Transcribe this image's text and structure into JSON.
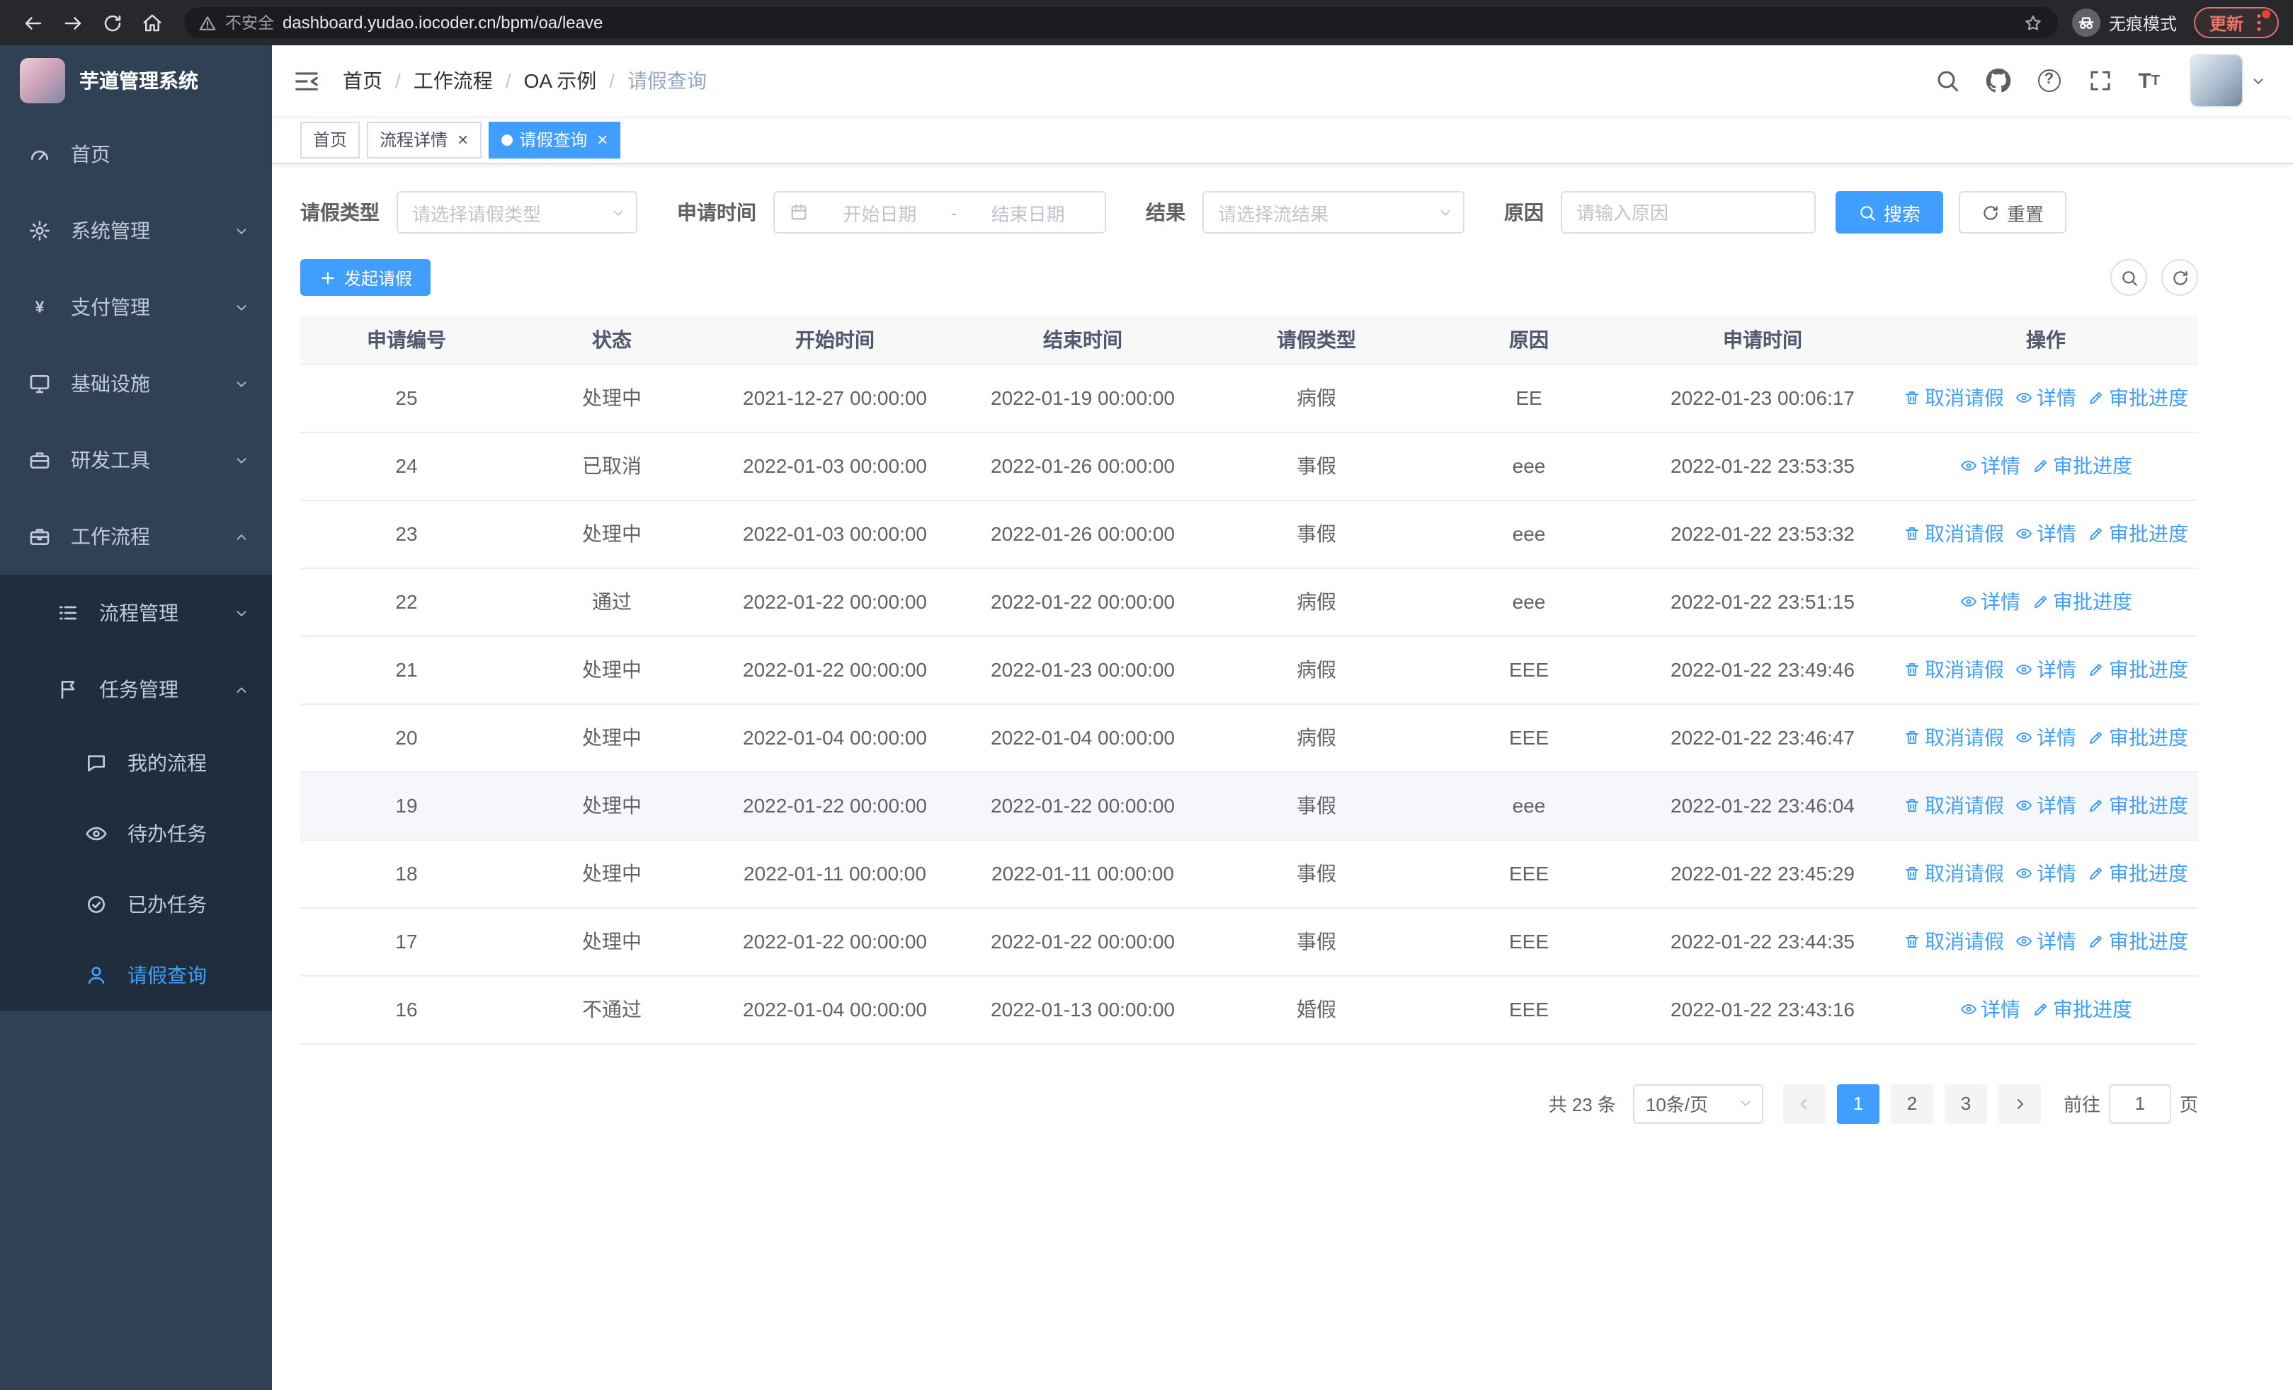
{
  "browser": {
    "security_label": "不安全",
    "url": "dashboard.yudao.iocoder.cn/bpm/oa/leave",
    "incognito_label": "无痕模式",
    "update_label": "更新"
  },
  "sidebar": {
    "logo_title": "芋道管理系统",
    "items": [
      {
        "key": "home",
        "label": "首页",
        "icon": "dashboard",
        "level": 1
      },
      {
        "key": "system",
        "label": "系统管理",
        "icon": "gear",
        "level": 1,
        "chevron": "down"
      },
      {
        "key": "payment",
        "label": "支付管理",
        "icon": "yen",
        "level": 1,
        "chevron": "down"
      },
      {
        "key": "infra",
        "label": "基础设施",
        "icon": "monitor",
        "level": 1,
        "chevron": "down"
      },
      {
        "key": "devtools",
        "label": "研发工具",
        "icon": "suitcase",
        "level": 1,
        "chevron": "down"
      },
      {
        "key": "workflow",
        "label": "工作流程",
        "icon": "briefcase",
        "level": 1,
        "chevron": "up",
        "open": true
      },
      {
        "key": "process-management",
        "label": "流程管理",
        "icon": "list",
        "level": 2,
        "chevron": "down"
      },
      {
        "key": "task-management",
        "label": "任务管理",
        "icon": "flag",
        "level": 2,
        "chevron": "up",
        "open": true
      },
      {
        "key": "my-process",
        "label": "我的流程",
        "icon": "chat",
        "level": 3
      },
      {
        "key": "todo-tasks",
        "label": "待办任务",
        "icon": "eye",
        "level": 3
      },
      {
        "key": "done-tasks",
        "label": "已办任务",
        "icon": "check-circle",
        "level": 3
      },
      {
        "key": "leave-query",
        "label": "请假查询",
        "icon": "user",
        "level": 3,
        "active": true
      }
    ]
  },
  "header": {
    "breadcrumb": [
      "首页",
      "工作流程",
      "OA 示例",
      "请假查询"
    ]
  },
  "tabs": [
    {
      "label": "首页",
      "closable": false,
      "active": false
    },
    {
      "label": "流程详情",
      "closable": true,
      "active": false
    },
    {
      "label": "请假查询",
      "closable": true,
      "active": true
    }
  ],
  "filters": {
    "leave_type_label": "请假类型",
    "leave_type_placeholder": "请选择请假类型",
    "apply_time_label": "申请时间",
    "start_date_placeholder": "开始日期",
    "range_separator": "-",
    "end_date_placeholder": "结束日期",
    "result_label": "结果",
    "result_placeholder": "请选择流结果",
    "reason_label": "原因",
    "reason_placeholder": "请输入原因",
    "search_button": "搜索",
    "reset_button": "重置"
  },
  "toolbar": {
    "create_button": "发起请假"
  },
  "table": {
    "columns": [
      "申请编号",
      "状态",
      "开始时间",
      "结束时间",
      "请假类型",
      "原因",
      "申请时间",
      "操作"
    ],
    "action_defs": {
      "cancel": {
        "label": "取消请假",
        "icon": "trash"
      },
      "detail": {
        "label": "详情",
        "icon": "eye"
      },
      "progress": {
        "label": "审批进度",
        "icon": "pen"
      }
    },
    "rows": [
      {
        "id": "25",
        "status": "处理中",
        "start": "2021-12-27 00:00:00",
        "end": "2022-01-19 00:00:00",
        "type": "病假",
        "reason": "EE",
        "apply_time": "2022-01-23 00:06:17",
        "actions": [
          "cancel",
          "detail",
          "progress"
        ],
        "highlight": false
      },
      {
        "id": "24",
        "status": "已取消",
        "start": "2022-01-03 00:00:00",
        "end": "2022-01-26 00:00:00",
        "type": "事假",
        "reason": "eee",
        "apply_time": "2022-01-22 23:53:35",
        "actions": [
          "detail",
          "progress"
        ],
        "highlight": false
      },
      {
        "id": "23",
        "status": "处理中",
        "start": "2022-01-03 00:00:00",
        "end": "2022-01-26 00:00:00",
        "type": "事假",
        "reason": "eee",
        "apply_time": "2022-01-22 23:53:32",
        "actions": [
          "cancel",
          "detail",
          "progress"
        ],
        "highlight": false
      },
      {
        "id": "22",
        "status": "通过",
        "start": "2022-01-22 00:00:00",
        "end": "2022-01-22 00:00:00",
        "type": "病假",
        "reason": "eee",
        "apply_time": "2022-01-22 23:51:15",
        "actions": [
          "detail",
          "progress"
        ],
        "highlight": false
      },
      {
        "id": "21",
        "status": "处理中",
        "start": "2022-01-22 00:00:00",
        "end": "2022-01-23 00:00:00",
        "type": "病假",
        "reason": "EEE",
        "apply_time": "2022-01-22 23:49:46",
        "actions": [
          "cancel",
          "detail",
          "progress"
        ],
        "highlight": false
      },
      {
        "id": "20",
        "status": "处理中",
        "start": "2022-01-04 00:00:00",
        "end": "2022-01-04 00:00:00",
        "type": "病假",
        "reason": "EEE",
        "apply_time": "2022-01-22 23:46:47",
        "actions": [
          "cancel",
          "detail",
          "progress"
        ],
        "highlight": false
      },
      {
        "id": "19",
        "status": "处理中",
        "start": "2022-01-22 00:00:00",
        "end": "2022-01-22 00:00:00",
        "type": "事假",
        "reason": "eee",
        "apply_time": "2022-01-22 23:46:04",
        "actions": [
          "cancel",
          "detail",
          "progress"
        ],
        "highlight": true
      },
      {
        "id": "18",
        "status": "处理中",
        "start": "2022-01-11 00:00:00",
        "end": "2022-01-11 00:00:00",
        "type": "事假",
        "reason": "EEE",
        "apply_time": "2022-01-22 23:45:29",
        "actions": [
          "cancel",
          "detail",
          "progress"
        ],
        "highlight": false
      },
      {
        "id": "17",
        "status": "处理中",
        "start": "2022-01-22 00:00:00",
        "end": "2022-01-22 00:00:00",
        "type": "事假",
        "reason": "EEE",
        "apply_time": "2022-01-22 23:44:35",
        "actions": [
          "cancel",
          "detail",
          "progress"
        ],
        "highlight": false
      },
      {
        "id": "16",
        "status": "不通过",
        "start": "2022-01-04 00:00:00",
        "end": "2022-01-13 00:00:00",
        "type": "婚假",
        "reason": "EEE",
        "apply_time": "2022-01-22 23:43:16",
        "actions": [
          "detail",
          "progress"
        ],
        "highlight": false
      }
    ]
  },
  "pagination": {
    "total_text": "共 23 条",
    "page_size": "10条/页",
    "pages": [
      "1",
      "2",
      "3"
    ],
    "active_page": "1",
    "goto_label": "前往",
    "goto_value": "1",
    "page_label": "页"
  },
  "colors": {
    "primary": "#409eff",
    "sidebar_bg": "#304156",
    "submenu_bg": "#1f2d3d"
  }
}
